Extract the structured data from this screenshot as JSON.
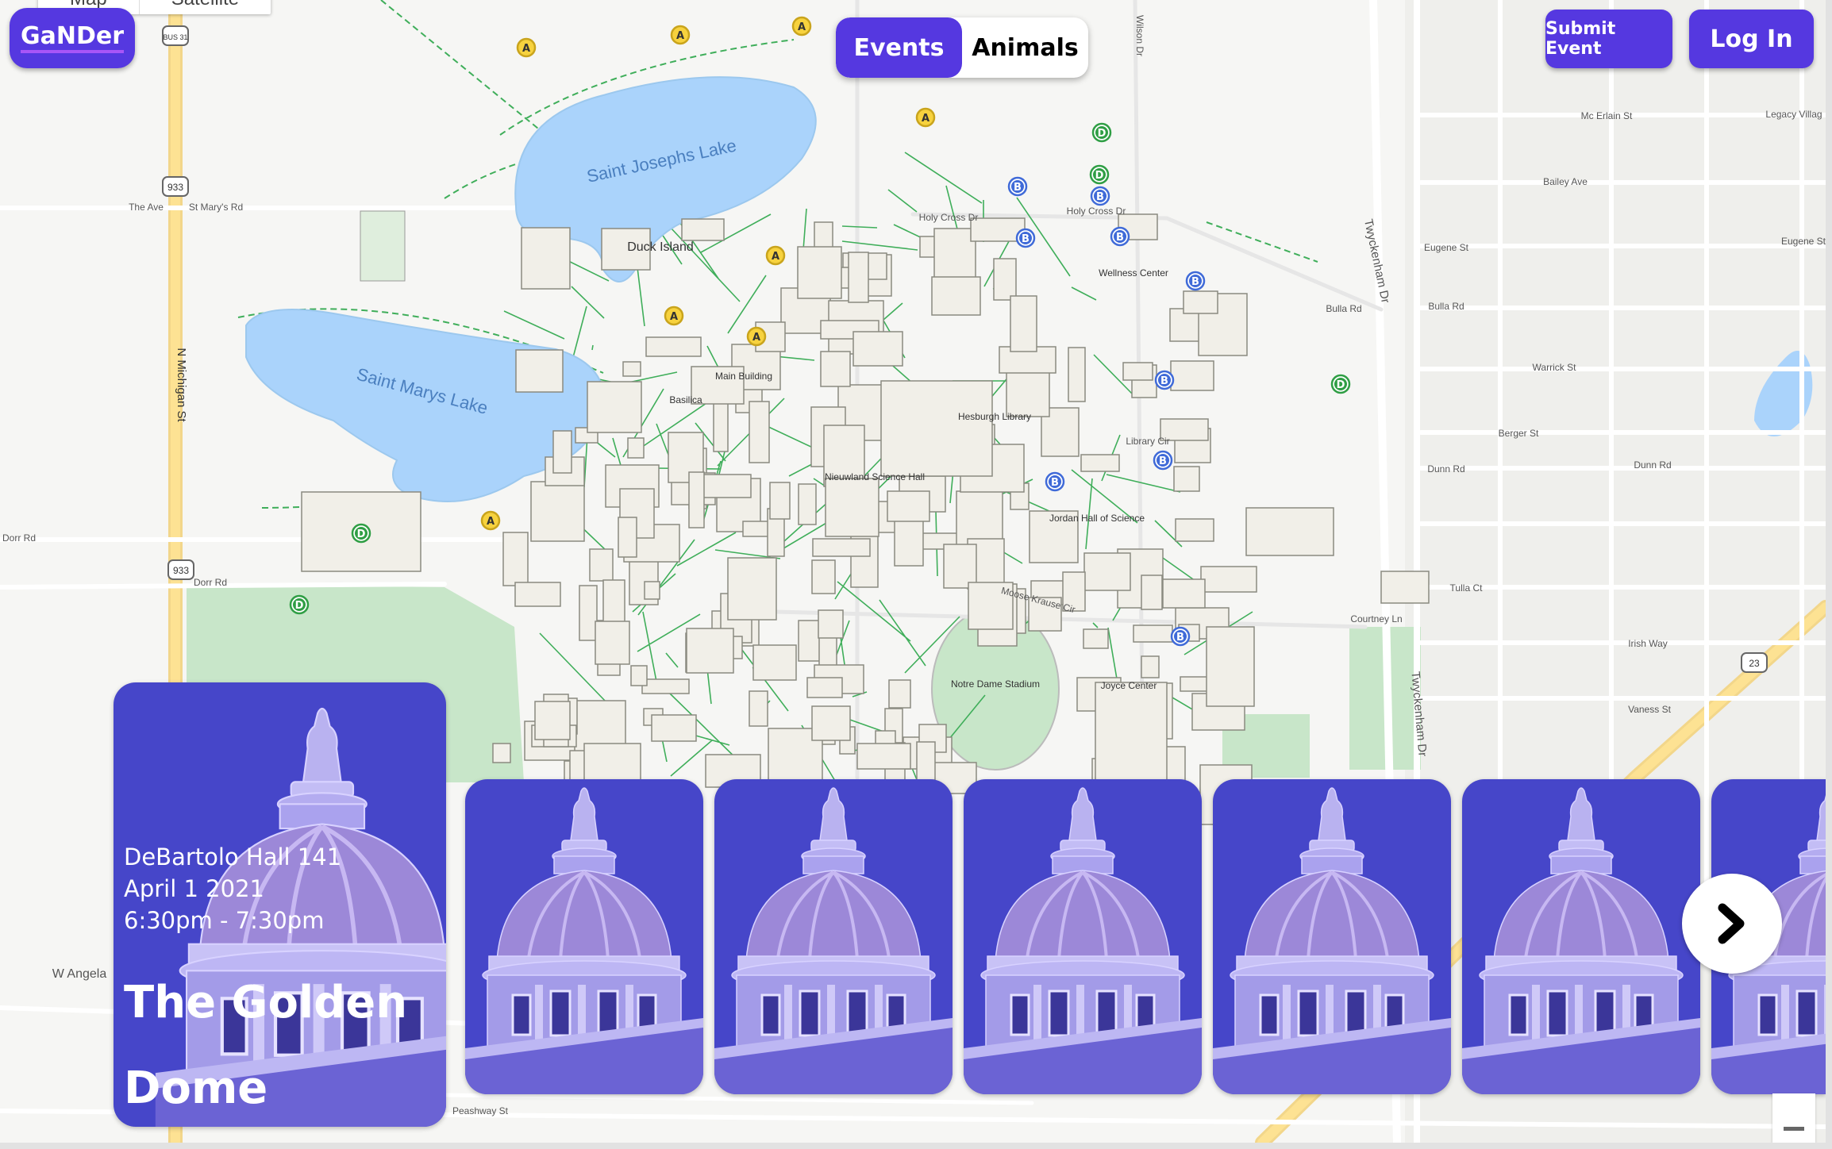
{
  "map": {
    "type_controls": [
      "Map",
      "Satellite"
    ],
    "labels": [
      "Saint Josephs Lake",
      "Saint Marys Lake",
      "Duck Island",
      "Main Building",
      "Basilica",
      "Hesburgh Library",
      "Nieuwland Science Hall",
      "Jordan Hall of Science",
      "Wellness Center",
      "Notre Dame Stadium",
      "Joyce Center",
      "N Michigan St",
      "Twyckenham Dr",
      "St Mary's Rd",
      "The Ave",
      "Dorr Rd",
      "Dorr Rd",
      "Holy Cross Dr",
      "Holy Cross Dr",
      "Bulla Rd",
      "Bulla Rd",
      "Mc Erlain St",
      "Bailey Ave",
      "Eugene St",
      "Warrick St",
      "Berger St",
      "Dunn Rd",
      "Dunn Rd",
      "Tulla Ct",
      "Irish Way",
      "Vaness St",
      "Courtney Ln",
      "Moose Krause Cir",
      "Library Cir",
      "Legacy Villag",
      "Peashway St",
      "W Angela",
      "Wilson Dr",
      "Twyckenham Dr",
      "Eugene St"
    ],
    "route_shields": [
      "BUS 31",
      "933",
      "933",
      "23"
    ],
    "markers": [
      "A",
      "A",
      "A",
      "A",
      "A",
      "A",
      "A",
      "A",
      "B",
      "B",
      "B",
      "B",
      "B",
      "B",
      "B",
      "B",
      "B",
      "D",
      "D",
      "D",
      "D",
      "D"
    ],
    "marker_colors": {
      "A": "#f7d23e",
      "B": "#3f6ad8",
      "D": "#2f9e44"
    }
  },
  "header": {
    "brand": "GaNDer",
    "tabs": [
      {
        "label": "Events",
        "active": true
      },
      {
        "label": "Animals",
        "active": false
      }
    ],
    "submit_label": "Submit Event",
    "login_label": "Log In"
  },
  "featured_event": {
    "location": "DeBartolo Hall 141",
    "date": "April 1 2021",
    "time": "6:30pm - 7:30pm",
    "title": "The Golden Dome"
  },
  "carousel": {
    "card_count": 7,
    "next_icon": "chevron-right-icon"
  },
  "colors": {
    "accent": "#5538e0",
    "card": "#4646c9",
    "lake": "#aad3fb",
    "park": "#c8e6c9",
    "path": "#3fae5a",
    "highway": "#fde293"
  }
}
